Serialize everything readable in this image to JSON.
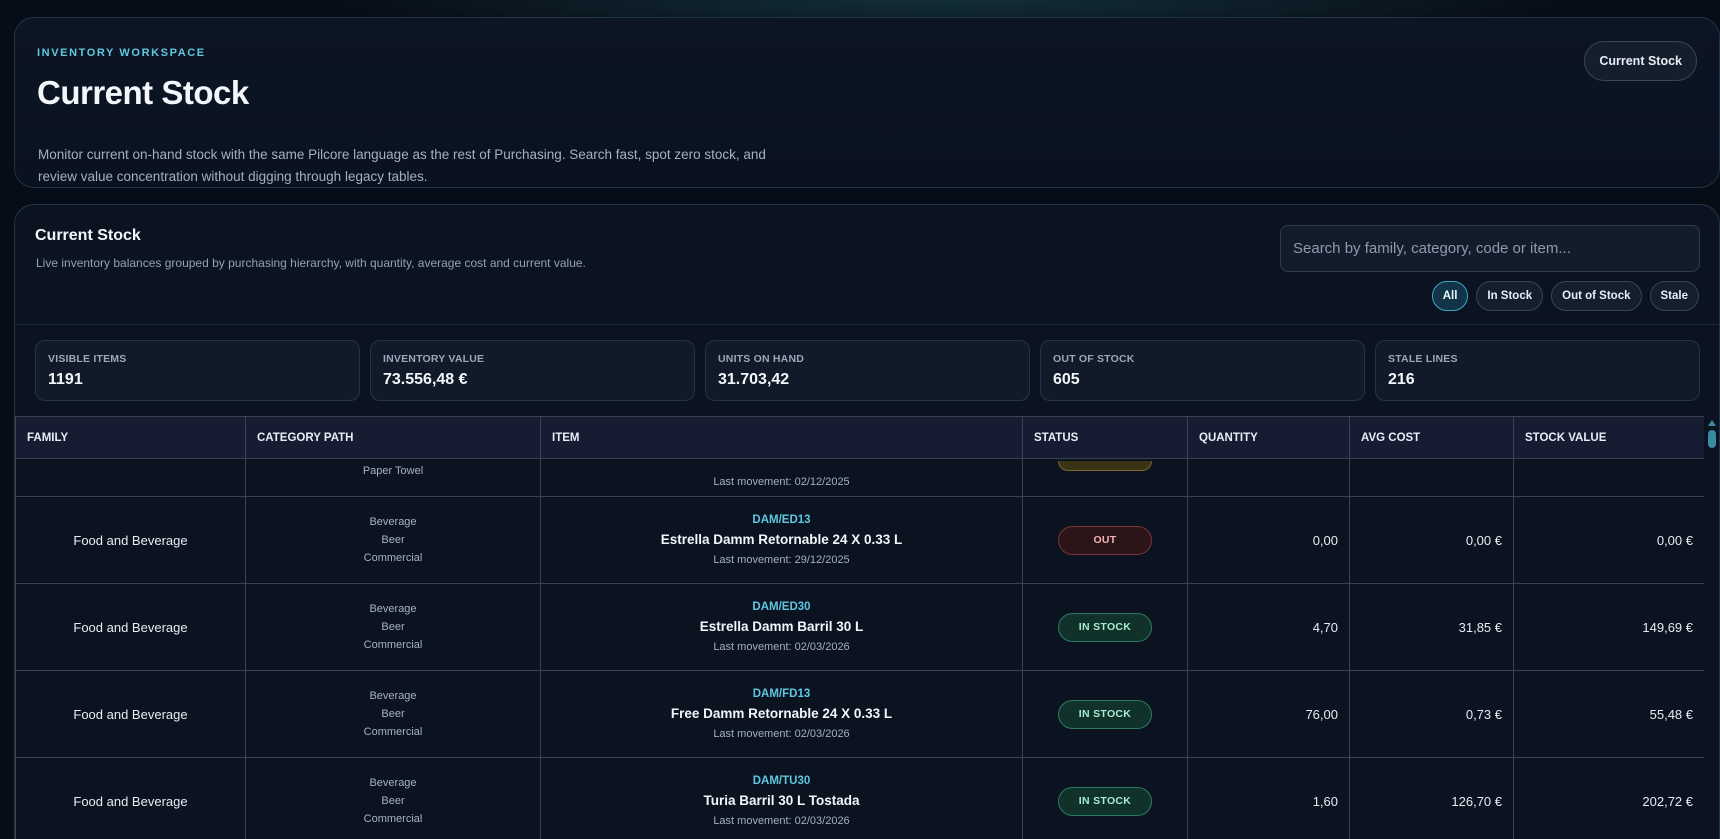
{
  "hero": {
    "eyebrow": "INVENTORY WORKSPACE",
    "title": "Current Stock",
    "description": "Monitor current on-hand stock with the same Pilcore language as the rest of Purchasing. Search fast, spot zero stock, and review value concentration without digging through legacy tables.",
    "badge": "Current Stock"
  },
  "panel": {
    "title": "Current Stock",
    "subtitle": "Live inventory balances grouped by purchasing hierarchy, with quantity, average cost and current value.",
    "search_placeholder": "Search by family, category, code or item...",
    "filters": [
      {
        "label": "All",
        "active": true
      },
      {
        "label": "In Stock",
        "active": false
      },
      {
        "label": "Out of Stock",
        "active": false
      },
      {
        "label": "Stale",
        "active": false
      }
    ]
  },
  "stats": [
    {
      "label": "VISIBLE ITEMS",
      "value": "1191"
    },
    {
      "label": "INVENTORY VALUE",
      "value": "73.556,48 €"
    },
    {
      "label": "UNITS ON HAND",
      "value": "31.703,42"
    },
    {
      "label": "OUT OF STOCK",
      "value": "605"
    },
    {
      "label": "STALE LINES",
      "value": "216"
    }
  ],
  "table": {
    "columns": [
      "FAMILY",
      "CATEGORY PATH",
      "ITEM",
      "STATUS",
      "QUANTITY",
      "AVG COST",
      "STOCK VALUE"
    ],
    "partial_row": {
      "category_last": "Paper Towel",
      "movement": "Last movement: 02/12/2025"
    },
    "rows": [
      {
        "family": "Food and Beverage",
        "category": [
          "Beverage",
          "Beer",
          "Commercial"
        ],
        "code": "DAM/ED13",
        "name": "Estrella Damm Retornable 24 X 0.33 L",
        "movement": "Last movement: 29/12/2025",
        "status": "OUT",
        "quantity": "0,00",
        "avg_cost": "0,00 €",
        "stock_value": "0,00 €"
      },
      {
        "family": "Food and Beverage",
        "category": [
          "Beverage",
          "Beer",
          "Commercial"
        ],
        "code": "DAM/ED30",
        "name": "Estrella Damm Barril 30 L",
        "movement": "Last movement: 02/03/2026",
        "status": "IN STOCK",
        "quantity": "4,70",
        "avg_cost": "31,85 €",
        "stock_value": "149,69 €"
      },
      {
        "family": "Food and Beverage",
        "category": [
          "Beverage",
          "Beer",
          "Commercial"
        ],
        "code": "DAM/FD13",
        "name": "Free Damm Retornable 24 X 0.33 L",
        "movement": "Last movement: 02/03/2026",
        "status": "IN STOCK",
        "quantity": "76,00",
        "avg_cost": "0,73 €",
        "stock_value": "55,48 €"
      },
      {
        "family": "Food and Beverage",
        "category": [
          "Beverage",
          "Beer",
          "Commercial"
        ],
        "code": "DAM/TU30",
        "name": "Turia Barril 30 L Tostada",
        "movement": "Last movement: 02/03/2026",
        "status": "IN STOCK",
        "quantity": "1,60",
        "avg_cost": "126,70 €",
        "stock_value": "202,72 €"
      }
    ]
  }
}
